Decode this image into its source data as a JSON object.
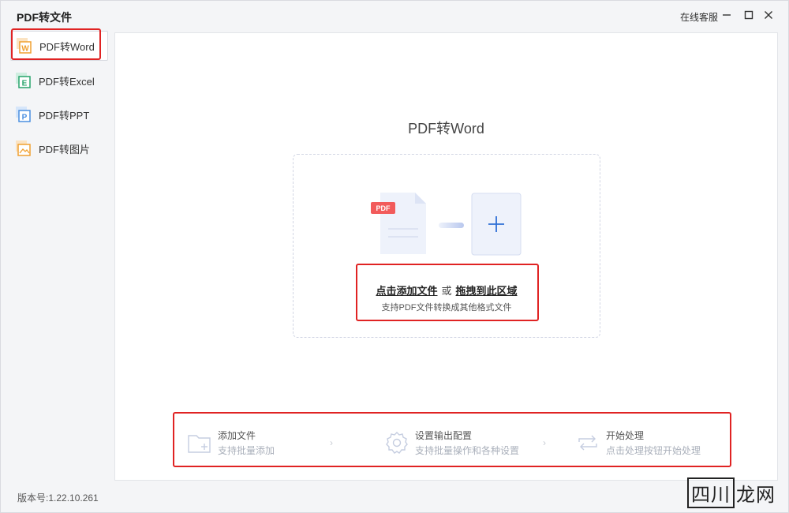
{
  "window": {
    "title": "PDF转文件",
    "online_service": "在线客服"
  },
  "sidebar": {
    "items": [
      {
        "label": "PDF转Word",
        "icon": "word-icon",
        "icon_letter": "W",
        "color": "#f0a030",
        "active": true
      },
      {
        "label": "PDF转Excel",
        "icon": "excel-icon",
        "icon_letter": "E",
        "color": "#27a36b",
        "active": false
      },
      {
        "label": "PDF转PPT",
        "icon": "ppt-icon",
        "icon_letter": "P",
        "color": "#4a8fe0",
        "active": false
      },
      {
        "label": "PDF转图片",
        "icon": "image-icon",
        "icon_letter": "",
        "color": "#f0a030",
        "active": false
      }
    ]
  },
  "version": "版本号:1.22.10.261",
  "main": {
    "title": "PDF转Word",
    "drop": {
      "pdf_badge": "PDF",
      "add_link": "点击添加文件",
      "or": "或",
      "drag_link": "拖拽到此区域",
      "hint": "支持PDF文件转换成其他格式文件"
    },
    "steps": [
      {
        "title": "添加文件",
        "subtitle": "支持批量添加",
        "icon": "folder-add-icon"
      },
      {
        "title": "设置输出配置",
        "subtitle": "支持批量操作和各种设置",
        "icon": "gear-icon"
      },
      {
        "title": "开始处理",
        "subtitle": "点击处理按钮开始处理",
        "icon": "repeat-icon"
      }
    ]
  },
  "watermark": {
    "boxed": "四川",
    "rest": "龙网"
  },
  "colors": {
    "highlight": "#e02323",
    "accent": "#2f6fd6",
    "pdf_badge": "#f25b5b"
  }
}
